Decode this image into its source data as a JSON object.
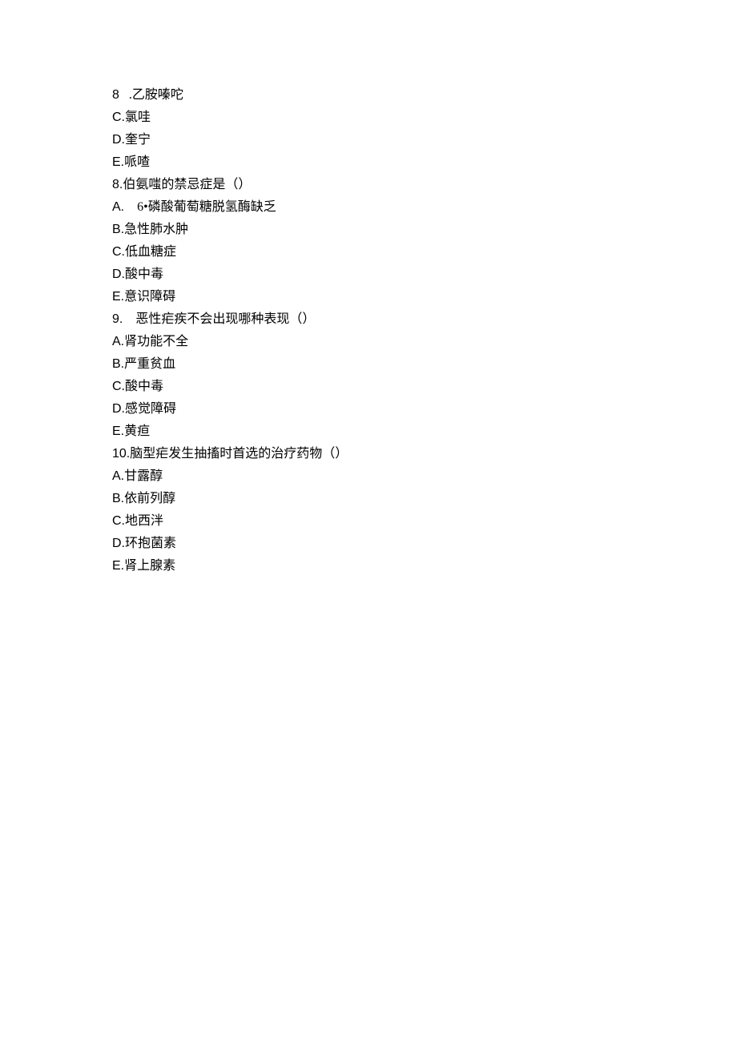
{
  "lines": [
    {
      "prefix": "8",
      "gap": "   ",
      "text": ".乙胺嗪咜"
    },
    {
      "prefix": "C.",
      "gap": "",
      "text": "氯哇"
    },
    {
      "prefix": "D.",
      "gap": "",
      "text": "奎宁"
    },
    {
      "prefix": "E.",
      "gap": "",
      "text": "哌喳"
    },
    {
      "prefix": "8.",
      "gap": "",
      "text": "伯氨嗤的禁忌症是（）"
    },
    {
      "prefix": "A.",
      "gap": "    ",
      "text": "6•磷酸葡萄糖脱氢酶缺乏"
    },
    {
      "prefix": "B.",
      "gap": "",
      "text": "急性肺水肿"
    },
    {
      "prefix": "C.",
      "gap": "",
      "text": "低血糖症"
    },
    {
      "prefix": "D.",
      "gap": "",
      "text": "酸中毒"
    },
    {
      "prefix": "E.",
      "gap": "",
      "text": "意识障碍"
    },
    {
      "prefix": "9.",
      "gap": "    ",
      "text": "恶性疟疾不会出现哪种表现（）"
    },
    {
      "prefix": "A.",
      "gap": "",
      "text": "肾功能不全"
    },
    {
      "prefix": "B.",
      "gap": "",
      "text": "严重贫血"
    },
    {
      "prefix": "C.",
      "gap": "",
      "text": "酸中毒"
    },
    {
      "prefix": "D.",
      "gap": "",
      "text": "感觉障碍"
    },
    {
      "prefix": "E.",
      "gap": "",
      "text": "黄疸"
    },
    {
      "prefix": "10.",
      "gap": "",
      "text": "脑型疟发生抽搐时首选的治疗药物（）"
    },
    {
      "prefix": "A.",
      "gap": "",
      "text": "甘露醇"
    },
    {
      "prefix": "B.",
      "gap": "",
      "text": "依前列醇"
    },
    {
      "prefix": "C.",
      "gap": "",
      "text": "地西泮"
    },
    {
      "prefix": "D.",
      "gap": "",
      "text": "环抱菌素"
    },
    {
      "prefix": "E.",
      "gap": "",
      "text": "肾上腺素"
    }
  ]
}
